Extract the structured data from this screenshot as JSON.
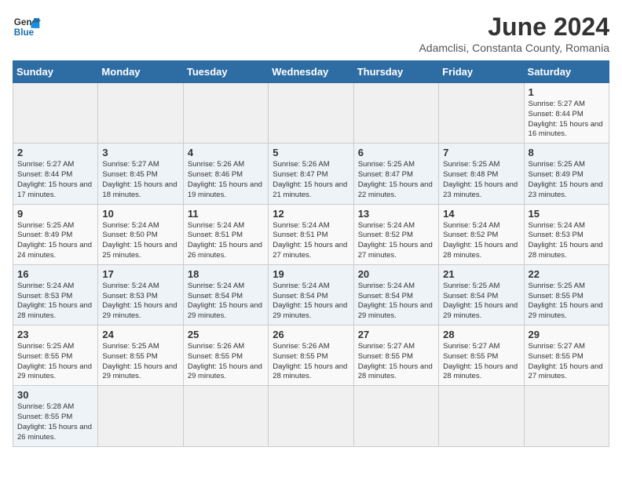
{
  "logo": {
    "text_general": "General",
    "text_blue": "Blue"
  },
  "title": "June 2024",
  "subtitle": "Adamclisi, Constanta County, Romania",
  "days_of_week": [
    "Sunday",
    "Monday",
    "Tuesday",
    "Wednesday",
    "Thursday",
    "Friday",
    "Saturday"
  ],
  "weeks": [
    [
      {
        "day": "",
        "info": ""
      },
      {
        "day": "",
        "info": ""
      },
      {
        "day": "",
        "info": ""
      },
      {
        "day": "",
        "info": ""
      },
      {
        "day": "",
        "info": ""
      },
      {
        "day": "",
        "info": ""
      },
      {
        "day": "1",
        "info": "Sunrise: 5:27 AM\nSunset: 8:44 PM\nDaylight: 15 hours and 16 minutes."
      }
    ],
    [
      {
        "day": "2",
        "info": "Sunrise: 5:27 AM\nSunset: 8:44 PM\nDaylight: 15 hours and 17 minutes."
      },
      {
        "day": "3",
        "info": "Sunrise: 5:27 AM\nSunset: 8:45 PM\nDaylight: 15 hours and 18 minutes."
      },
      {
        "day": "4",
        "info": "Sunrise: 5:26 AM\nSunset: 8:46 PM\nDaylight: 15 hours and 19 minutes."
      },
      {
        "day": "5",
        "info": "Sunrise: 5:26 AM\nSunset: 8:47 PM\nDaylight: 15 hours and 21 minutes."
      },
      {
        "day": "6",
        "info": "Sunrise: 5:25 AM\nSunset: 8:47 PM\nDaylight: 15 hours and 22 minutes."
      },
      {
        "day": "7",
        "info": "Sunrise: 5:25 AM\nSunset: 8:48 PM\nDaylight: 15 hours and 23 minutes."
      },
      {
        "day": "8",
        "info": "Sunrise: 5:25 AM\nSunset: 8:49 PM\nDaylight: 15 hours and 23 minutes."
      }
    ],
    [
      {
        "day": "9",
        "info": "Sunrise: 5:25 AM\nSunset: 8:49 PM\nDaylight: 15 hours and 24 minutes."
      },
      {
        "day": "10",
        "info": "Sunrise: 5:24 AM\nSunset: 8:50 PM\nDaylight: 15 hours and 25 minutes."
      },
      {
        "day": "11",
        "info": "Sunrise: 5:24 AM\nSunset: 8:51 PM\nDaylight: 15 hours and 26 minutes."
      },
      {
        "day": "12",
        "info": "Sunrise: 5:24 AM\nSunset: 8:51 PM\nDaylight: 15 hours and 27 minutes."
      },
      {
        "day": "13",
        "info": "Sunrise: 5:24 AM\nSunset: 8:52 PM\nDaylight: 15 hours and 27 minutes."
      },
      {
        "day": "14",
        "info": "Sunrise: 5:24 AM\nSunset: 8:52 PM\nDaylight: 15 hours and 28 minutes."
      },
      {
        "day": "15",
        "info": "Sunrise: 5:24 AM\nSunset: 8:53 PM\nDaylight: 15 hours and 28 minutes."
      }
    ],
    [
      {
        "day": "16",
        "info": "Sunrise: 5:24 AM\nSunset: 8:53 PM\nDaylight: 15 hours and 28 minutes."
      },
      {
        "day": "17",
        "info": "Sunrise: 5:24 AM\nSunset: 8:53 PM\nDaylight: 15 hours and 29 minutes."
      },
      {
        "day": "18",
        "info": "Sunrise: 5:24 AM\nSunset: 8:54 PM\nDaylight: 15 hours and 29 minutes."
      },
      {
        "day": "19",
        "info": "Sunrise: 5:24 AM\nSunset: 8:54 PM\nDaylight: 15 hours and 29 minutes."
      },
      {
        "day": "20",
        "info": "Sunrise: 5:24 AM\nSunset: 8:54 PM\nDaylight: 15 hours and 29 minutes."
      },
      {
        "day": "21",
        "info": "Sunrise: 5:25 AM\nSunset: 8:54 PM\nDaylight: 15 hours and 29 minutes."
      },
      {
        "day": "22",
        "info": "Sunrise: 5:25 AM\nSunset: 8:55 PM\nDaylight: 15 hours and 29 minutes."
      }
    ],
    [
      {
        "day": "23",
        "info": "Sunrise: 5:25 AM\nSunset: 8:55 PM\nDaylight: 15 hours and 29 minutes."
      },
      {
        "day": "24",
        "info": "Sunrise: 5:25 AM\nSunset: 8:55 PM\nDaylight: 15 hours and 29 minutes."
      },
      {
        "day": "25",
        "info": "Sunrise: 5:26 AM\nSunset: 8:55 PM\nDaylight: 15 hours and 29 minutes."
      },
      {
        "day": "26",
        "info": "Sunrise: 5:26 AM\nSunset: 8:55 PM\nDaylight: 15 hours and 28 minutes."
      },
      {
        "day": "27",
        "info": "Sunrise: 5:27 AM\nSunset: 8:55 PM\nDaylight: 15 hours and 28 minutes."
      },
      {
        "day": "28",
        "info": "Sunrise: 5:27 AM\nSunset: 8:55 PM\nDaylight: 15 hours and 28 minutes."
      },
      {
        "day": "29",
        "info": "Sunrise: 5:27 AM\nSunset: 8:55 PM\nDaylight: 15 hours and 27 minutes."
      }
    ],
    [
      {
        "day": "30",
        "info": "Sunrise: 5:28 AM\nSunset: 8:55 PM\nDaylight: 15 hours and 26 minutes."
      },
      {
        "day": "",
        "info": ""
      },
      {
        "day": "",
        "info": ""
      },
      {
        "day": "",
        "info": ""
      },
      {
        "day": "",
        "info": ""
      },
      {
        "day": "",
        "info": ""
      },
      {
        "day": "",
        "info": ""
      }
    ]
  ]
}
